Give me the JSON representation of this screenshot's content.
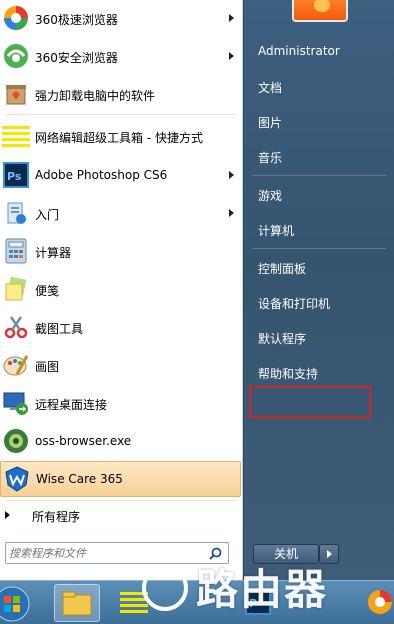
{
  "programs": [
    {
      "label": "360极速浏览器",
      "icon": "browser-360-speed-icon",
      "arrow": true
    },
    {
      "label": "360安全浏览器",
      "icon": "browser-360-safe-icon",
      "arrow": true
    },
    {
      "label": "强力卸载电脑中的软件",
      "icon": "uninstall-icon",
      "arrow": false
    },
    {
      "label": "网络编辑超级工具箱 - 快捷方式",
      "icon": "toolbox-icon",
      "arrow": false
    },
    {
      "label": "Adobe Photoshop CS6",
      "icon": "photoshop-icon",
      "arrow": true
    },
    {
      "label": "入门",
      "icon": "getting-started-icon",
      "arrow": true
    },
    {
      "label": "计算器",
      "icon": "calculator-icon",
      "arrow": false
    },
    {
      "label": "便笺",
      "icon": "sticky-notes-icon",
      "arrow": false
    },
    {
      "label": "截图工具",
      "icon": "snipping-tool-icon",
      "arrow": false
    },
    {
      "label": "画图",
      "icon": "paint-icon",
      "arrow": false
    },
    {
      "label": "远程桌面连接",
      "icon": "remote-desktop-icon",
      "arrow": false
    },
    {
      "label": "oss-browser.exe",
      "icon": "oss-browser-icon",
      "arrow": false
    },
    {
      "label": "Wise Care 365",
      "icon": "wise-care-icon",
      "arrow": false
    }
  ],
  "all_programs_label": "所有程序",
  "search": {
    "placeholder": "搜索程序和文件"
  },
  "right_menu": [
    "Administrator",
    "文档",
    "图片",
    "音乐",
    "游戏",
    "计算机",
    "控制面板",
    "设备和打印机",
    "默认程序",
    "帮助和支持"
  ],
  "shutdown_label": "关机",
  "watermark": "路由器",
  "colors": {
    "highlight": "#f9d199",
    "red_box": "#d2202a",
    "panel_dark": "#35556f"
  }
}
